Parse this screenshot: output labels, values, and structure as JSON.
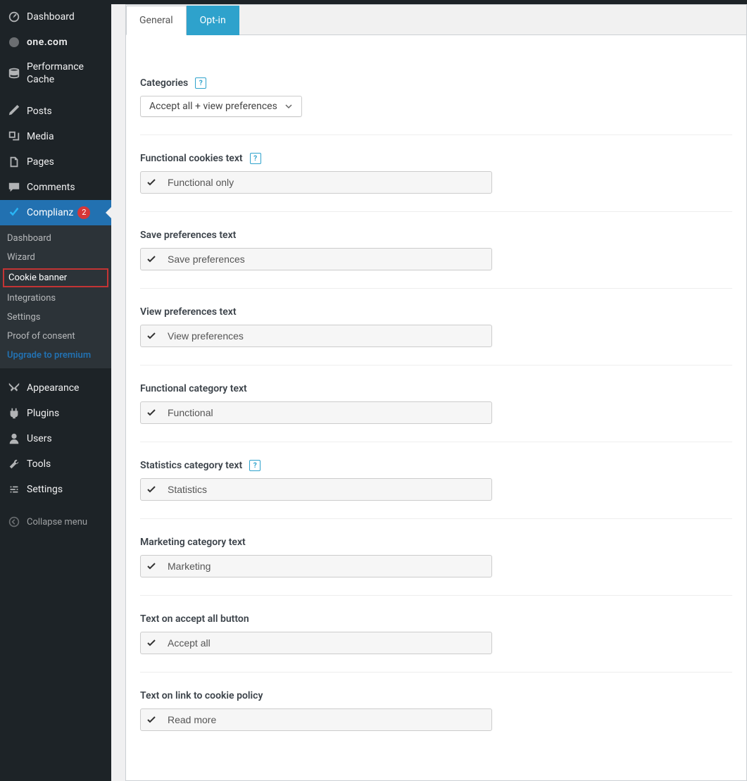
{
  "sidebar": {
    "items": [
      {
        "label": "Dashboard"
      },
      {
        "label": "one.com"
      },
      {
        "label": "Performance Cache"
      },
      {
        "label": "Posts"
      },
      {
        "label": "Media"
      },
      {
        "label": "Pages"
      },
      {
        "label": "Comments"
      },
      {
        "label": "Complianz",
        "badge": "2"
      },
      {
        "label": "Appearance"
      },
      {
        "label": "Plugins"
      },
      {
        "label": "Users"
      },
      {
        "label": "Tools"
      },
      {
        "label": "Settings"
      }
    ],
    "submenu": [
      {
        "label": "Dashboard"
      },
      {
        "label": "Wizard"
      },
      {
        "label": "Cookie banner"
      },
      {
        "label": "Integrations"
      },
      {
        "label": "Settings"
      },
      {
        "label": "Proof of consent"
      },
      {
        "label": "Upgrade to premium"
      }
    ],
    "collapse": "Collapse menu"
  },
  "tabs": {
    "general": "General",
    "optin": "Opt-in"
  },
  "fields": {
    "categories_label": "Categories",
    "categories_value": "Accept all + view preferences",
    "functional_cookies_label": "Functional cookies text",
    "functional_cookies_value": "Functional only",
    "save_prefs_label": "Save preferences text",
    "save_prefs_value": "Save preferences",
    "view_prefs_label": "View preferences text",
    "view_prefs_value": "View preferences",
    "functional_cat_label": "Functional category text",
    "functional_cat_value": "Functional",
    "stats_cat_label": "Statistics category text",
    "stats_cat_value": "Statistics",
    "marketing_cat_label": "Marketing category text",
    "marketing_cat_value": "Marketing",
    "accept_all_label": "Text on accept all button",
    "accept_all_value": "Accept all",
    "cookie_policy_label": "Text on link to cookie policy",
    "cookie_policy_value": "Read more"
  }
}
